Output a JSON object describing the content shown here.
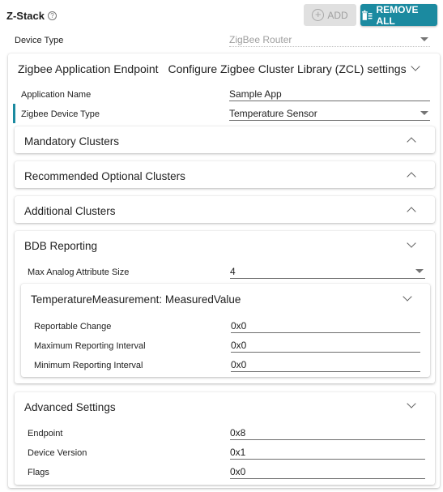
{
  "header": {
    "title": "Z-Stack",
    "help_icon": "?",
    "add_label": "ADD",
    "remove_all_label": "REMOVE ALL"
  },
  "device_type": {
    "label": "Device Type",
    "value": "ZigBee Router"
  },
  "endpoint_section": {
    "title": "Zigbee Application Endpoint",
    "subtitle": "Configure Zigbee Cluster Library (ZCL) settings",
    "application_name": {
      "label": "Application Name",
      "value": "Sample App"
    },
    "device_type": {
      "label": "Zigbee Device Type",
      "value": "Temperature Sensor"
    },
    "mandatory": "Mandatory Clusters",
    "recommended": "Recommended Optional Clusters",
    "additional": "Additional Clusters",
    "bdb": {
      "title": "BDB Reporting",
      "max_analog": {
        "label": "Max Analog Attribute Size",
        "value": "4"
      },
      "measurement": {
        "title": "TemperatureMeasurement: MeasuredValue",
        "reportable_change": {
          "label": "Reportable Change",
          "value": "0x0"
        },
        "max_interval": {
          "label": "Maximum Reporting Interval",
          "value": "0x0"
        },
        "min_interval": {
          "label": "Minimum Reporting Interval",
          "value": "0x0"
        }
      }
    },
    "advanced": {
      "title": "Advanced Settings",
      "endpoint": {
        "label": "Endpoint",
        "value": "0x8"
      },
      "device_version": {
        "label": "Device Version",
        "value": "0x1"
      },
      "flags": {
        "label": "Flags",
        "value": "0x0"
      }
    }
  },
  "colors": {
    "accent": "#1b8aa0",
    "disabled": "#e0e0e0"
  }
}
